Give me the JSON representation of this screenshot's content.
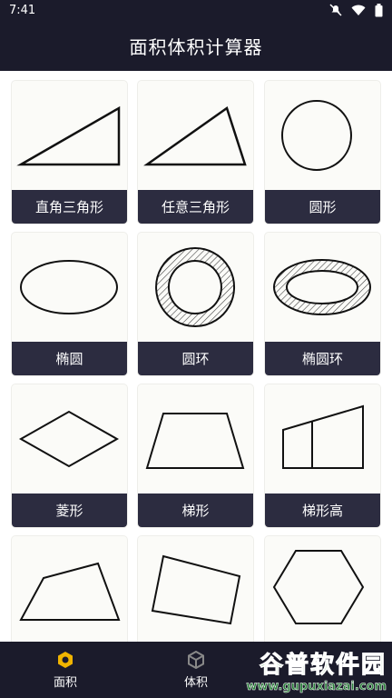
{
  "status": {
    "time": "7:41"
  },
  "appbar": {
    "title": "面积体积计算器"
  },
  "shapes": [
    {
      "label": "直角三角形",
      "icon": "right-triangle-icon"
    },
    {
      "label": "任意三角形",
      "icon": "triangle-icon"
    },
    {
      "label": "圆形",
      "icon": "circle-icon"
    },
    {
      "label": "椭圆",
      "icon": "ellipse-icon"
    },
    {
      "label": "圆环",
      "icon": "ring-icon"
    },
    {
      "label": "椭圆环",
      "icon": "elliptical-ring-icon"
    },
    {
      "label": "菱形",
      "icon": "rhombus-icon"
    },
    {
      "label": "梯形",
      "icon": "trapezoid-icon"
    },
    {
      "label": "梯形高",
      "icon": "trapezoid-height-icon"
    },
    {
      "label": "",
      "icon": "quadrilateral-icon"
    },
    {
      "label": "",
      "icon": "quadrilateral-icon"
    },
    {
      "label": "",
      "icon": "hexagon-icon"
    }
  ],
  "bottomnav": {
    "items": [
      {
        "label": "面积",
        "icon": "hexagon-icon",
        "active": true
      },
      {
        "label": "体积",
        "icon": "cube-icon",
        "active": false
      }
    ]
  },
  "watermark": {
    "big": "谷普软件园",
    "small": "www.gupuxiazai.com"
  },
  "colors": {
    "bar": "#1b1b2b",
    "label_bg": "#2c2c40",
    "active": "#f0b400"
  }
}
